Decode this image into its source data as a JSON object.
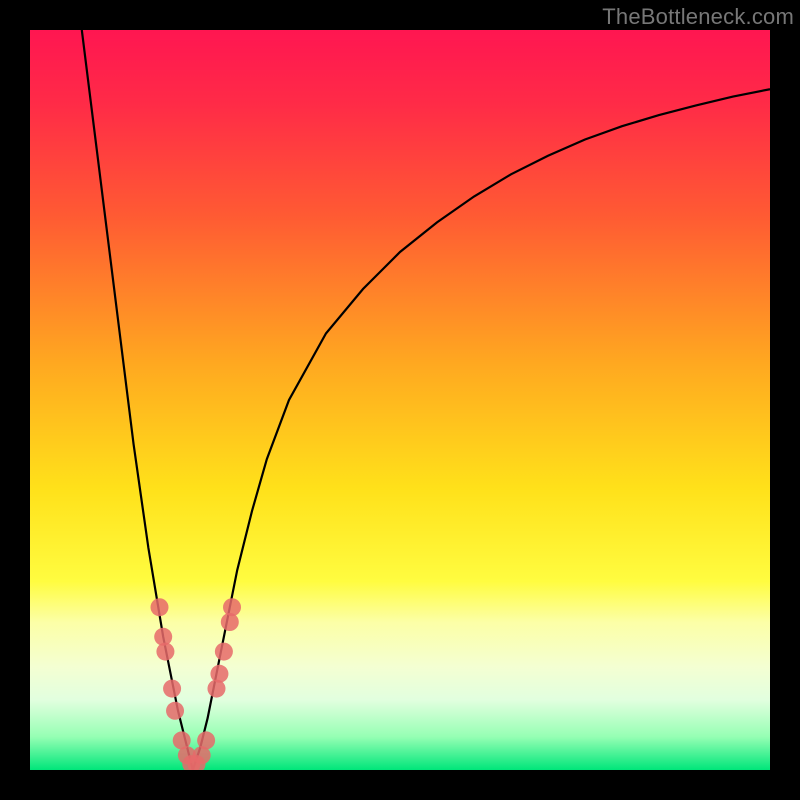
{
  "watermark": "TheBottleneck.com",
  "colors": {
    "black": "#000000",
    "curve": "#000000",
    "marker_fill": "#e66a6a",
    "marker_stroke": "#7a2a2a"
  },
  "gradient_stops": [
    {
      "offset": 0.0,
      "color": "#ff1651"
    },
    {
      "offset": 0.1,
      "color": "#ff2b47"
    },
    {
      "offset": 0.25,
      "color": "#ff5a33"
    },
    {
      "offset": 0.45,
      "color": "#ffa820"
    },
    {
      "offset": 0.62,
      "color": "#ffe11a"
    },
    {
      "offset": 0.745,
      "color": "#fffc40"
    },
    {
      "offset": 0.8,
      "color": "#fcffa6"
    },
    {
      "offset": 0.86,
      "color": "#f4ffd2"
    },
    {
      "offset": 0.905,
      "color": "#e2ffdf"
    },
    {
      "offset": 0.955,
      "color": "#96ffb4"
    },
    {
      "offset": 1.0,
      "color": "#00e67a"
    }
  ],
  "chart_data": {
    "type": "line",
    "title": "",
    "xlabel": "",
    "ylabel": "",
    "xlim": [
      0,
      100
    ],
    "ylim": [
      0,
      100
    ],
    "x_optimum": 22,
    "series": [
      {
        "name": "bottleneck-curve",
        "x": [
          7,
          8,
          9,
          10,
          11,
          12,
          13,
          14,
          15,
          16,
          17,
          18,
          19,
          20,
          21,
          22,
          23,
          24,
          25,
          26,
          27,
          28,
          30,
          32,
          35,
          40,
          45,
          50,
          55,
          60,
          65,
          70,
          75,
          80,
          85,
          90,
          95,
          100
        ],
        "y": [
          100,
          92,
          84,
          76,
          68,
          60,
          52,
          44,
          37,
          30,
          24,
          18,
          13,
          8,
          4,
          0,
          3,
          7,
          12,
          17,
          22,
          27,
          35,
          42,
          50,
          59,
          65,
          70,
          74,
          77.5,
          80.5,
          83,
          85.2,
          87,
          88.5,
          89.8,
          91,
          92
        ]
      }
    ],
    "markers": {
      "name": "sample-points",
      "points": [
        {
          "x": 17.5,
          "y": 22
        },
        {
          "x": 18.0,
          "y": 18
        },
        {
          "x": 18.3,
          "y": 16
        },
        {
          "x": 19.2,
          "y": 11
        },
        {
          "x": 19.6,
          "y": 8
        },
        {
          "x": 20.5,
          "y": 4
        },
        {
          "x": 21.2,
          "y": 2
        },
        {
          "x": 21.8,
          "y": 0.8
        },
        {
          "x": 22.5,
          "y": 0.8
        },
        {
          "x": 23.2,
          "y": 2
        },
        {
          "x": 23.8,
          "y": 4
        },
        {
          "x": 25.2,
          "y": 11
        },
        {
          "x": 25.6,
          "y": 13
        },
        {
          "x": 26.2,
          "y": 16
        },
        {
          "x": 27.0,
          "y": 20
        },
        {
          "x": 27.3,
          "y": 22
        }
      ]
    }
  }
}
